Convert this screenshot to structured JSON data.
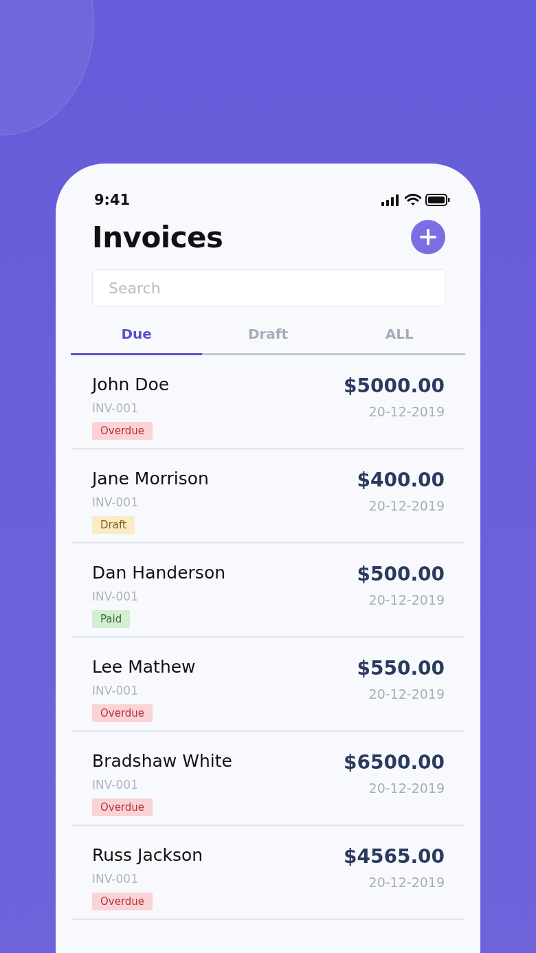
{
  "status_bar": {
    "time": "9:41"
  },
  "header": {
    "title": "Invoices"
  },
  "search": {
    "placeholder": "Search"
  },
  "tabs": [
    {
      "label": "Due",
      "selected": true
    },
    {
      "label": "Draft",
      "selected": false
    },
    {
      "label": "ALL",
      "selected": false
    }
  ],
  "invoices": [
    {
      "name": "John Doe",
      "number": "INV-001",
      "status": {
        "label": "Overdue",
        "kind": "overdue"
      },
      "amount": "$5000.00",
      "date": "20-12-2019"
    },
    {
      "name": "Jane Morrison",
      "number": "INV-001",
      "status": {
        "label": "Draft",
        "kind": "draft"
      },
      "amount": "$400.00",
      "date": "20-12-2019"
    },
    {
      "name": "Dan Handerson",
      "number": "INV-001",
      "status": {
        "label": "Paid",
        "kind": "paid"
      },
      "amount": "$500.00",
      "date": "20-12-2019"
    },
    {
      "name": "Lee Mathew",
      "number": "INV-001",
      "status": {
        "label": "Overdue",
        "kind": "overdue"
      },
      "amount": "$550.00",
      "date": "20-12-2019"
    },
    {
      "name": "Bradshaw White",
      "number": "INV-001",
      "status": {
        "label": "Overdue",
        "kind": "overdue"
      },
      "amount": "$6500.00",
      "date": "20-12-2019"
    },
    {
      "name": "Russ Jackson",
      "number": "INV-001",
      "status": {
        "label": "Overdue",
        "kind": "overdue"
      },
      "amount": "$4565.00",
      "date": "20-12-2019"
    }
  ]
}
